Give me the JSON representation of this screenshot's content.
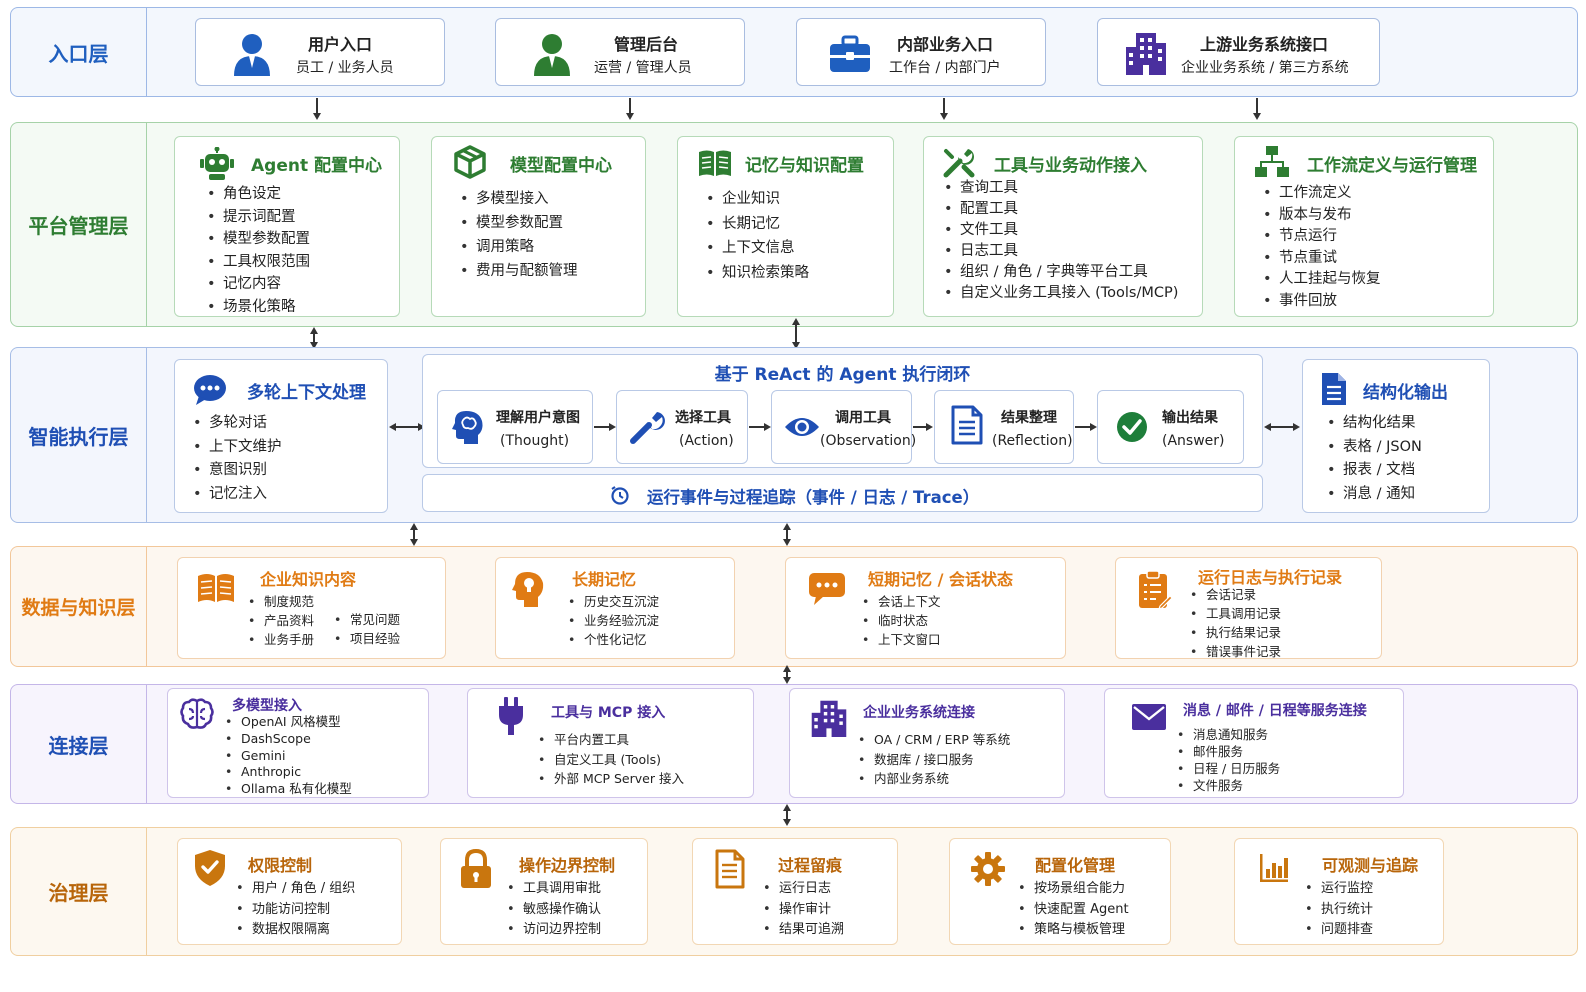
{
  "colors": {
    "entry_blue": "#1f5fbf",
    "platform_green": "#2e7d32",
    "exec_blue": "#1f4fb4",
    "data_orange": "#e07b14",
    "connect_purple": "#4a2f9e",
    "gov_orange": "#b8650a"
  },
  "entry": {
    "label": "入口层",
    "cards": [
      {
        "title": "用户入口",
        "sub": "员工 / 业务人员",
        "icon": "user-icon"
      },
      {
        "title": "管理后台",
        "sub": "运营 / 管理人员",
        "icon": "admin-user-icon"
      },
      {
        "title": "内部业务入口",
        "sub": "工作台 / 内部门户",
        "icon": "briefcase-icon"
      },
      {
        "title": "上游业务系统接口",
        "sub": "企业业务系统 / 第三方系统",
        "icon": "building-icon"
      }
    ]
  },
  "platform": {
    "label": "平台管理层",
    "cards": [
      {
        "title": "Agent 配置中心",
        "icon": "robot-icon",
        "items": [
          "角色设定",
          "提示词配置",
          "模型参数配置",
          "工具权限范围",
          "记忆内容",
          "场景化策略"
        ]
      },
      {
        "title": "模型配置中心",
        "icon": "cube-icon",
        "items": [
          "多模型接入",
          "模型参数配置",
          "调用策略",
          "费用与配额管理"
        ]
      },
      {
        "title": "记忆与知识配置",
        "icon": "book-icon",
        "items": [
          "企业知识",
          "长期记忆",
          "上下文信息",
          "知识检索策略"
        ]
      },
      {
        "title": "工具与业务动作接入",
        "icon": "tools-icon",
        "items": [
          "查询工具",
          "配置工具",
          "文件工具",
          "日志工具",
          "组织 / 角色 / 字典等平台工具",
          "自定义业务工具接入 (Tools/MCP)"
        ]
      },
      {
        "title": "工作流定义与运行管理",
        "icon": "workflow-icon",
        "items": [
          "工作流定义",
          "版本与发布",
          "节点运行",
          "节点重试",
          "人工挂起与恢复",
          "事件回放"
        ]
      }
    ]
  },
  "exec": {
    "label": "智能执行层",
    "left": {
      "title": "多轮上下文处理",
      "icon": "chat-bubble-icon",
      "items": [
        "多轮对话",
        "上下文维护",
        "意图识别",
        "记忆注入"
      ]
    },
    "react_title": "基于 ReAct 的 Agent 执行闭环",
    "steps": [
      {
        "t1": "理解用户意图",
        "t2": "(Thought)",
        "icon": "brain-head-icon"
      },
      {
        "t1": "选择工具",
        "t2": "(Action)",
        "icon": "wrench-icon"
      },
      {
        "t1": "调用工具",
        "t2": "(Observation)",
        "icon": "eye-icon"
      },
      {
        "t1": "结果整理",
        "t2": "(Reflection)",
        "icon": "document-icon"
      },
      {
        "t1": "输出结果",
        "t2": "(Answer)",
        "icon": "check-circle-icon"
      }
    ],
    "trace": "运行事件与过程追踪（事件 / 日志 / Trace）",
    "right": {
      "title": "结构化输出",
      "icon": "file-icon",
      "items": [
        "结构化结果",
        "表格 / JSON",
        "报表 / 文档",
        "消息 / 通知"
      ]
    }
  },
  "data": {
    "label": "数据与知识层",
    "cards": [
      {
        "title": "企业知识内容",
        "icon": "open-book-icon",
        "col1": [
          "制度规范",
          "产品资料",
          "业务手册"
        ],
        "col2": [
          "常见问题",
          "项目经验"
        ]
      },
      {
        "title": "长期记忆",
        "icon": "lightbulb-head-icon",
        "items": [
          "历史交互沉淀",
          "业务经验沉淀",
          "个性化记忆"
        ]
      },
      {
        "title": "短期记忆 / 会话状态",
        "icon": "chat-icon",
        "items": [
          "会话上下文",
          "临时状态",
          "上下文窗口"
        ]
      },
      {
        "title": "运行日志与执行记录",
        "icon": "clipboard-icon",
        "items": [
          "会话记录",
          "工具调用记录",
          "执行结果记录",
          "错误事件记录"
        ]
      }
    ]
  },
  "connect": {
    "label": "连接层",
    "cards": [
      {
        "title": "多模型接入",
        "icon": "brain-icon",
        "items": [
          "OpenAI 风格模型",
          "DashScope",
          "Gemini",
          "Anthropic",
          "Ollama 私有化模型"
        ]
      },
      {
        "title": "工具与 MCP 接入",
        "icon": "plug-icon",
        "items": [
          "平台内置工具",
          "自定义工具 (Tools)",
          "外部 MCP Server 接入"
        ]
      },
      {
        "title": "企业业务系统连接",
        "icon": "building-icon",
        "items": [
          "OA / CRM / ERP 等系统",
          "数据库 / 接口服务",
          "内部业务系统"
        ]
      },
      {
        "title": "消息 / 邮件 / 日程等服务连接",
        "icon": "mail-icon",
        "items": [
          "消息通知服务",
          "邮件服务",
          "日程 / 日历服务",
          "文件服务"
        ]
      }
    ]
  },
  "gov": {
    "label": "治理层",
    "cards": [
      {
        "title": "权限控制",
        "icon": "shield-icon",
        "items": [
          "用户 / 角色 / 组织",
          "功能访问控制",
          "数据权限隔离"
        ]
      },
      {
        "title": "操作边界控制",
        "icon": "lock-icon",
        "items": [
          "工具调用审批",
          "敏感操作确认",
          "访问边界控制"
        ]
      },
      {
        "title": "过程留痕",
        "icon": "doc-lines-icon",
        "items": [
          "运行日志",
          "操作审计",
          "结果可追溯"
        ]
      },
      {
        "title": "配置化管理",
        "icon": "gear-icon",
        "items": [
          "按场景组合能力",
          "快速配置 Agent",
          "策略与模板管理"
        ]
      },
      {
        "title": "可观测与追踪",
        "icon": "bar-chart-icon",
        "items": [
          "运行监控",
          "执行统计",
          "问题排查"
        ]
      }
    ]
  }
}
